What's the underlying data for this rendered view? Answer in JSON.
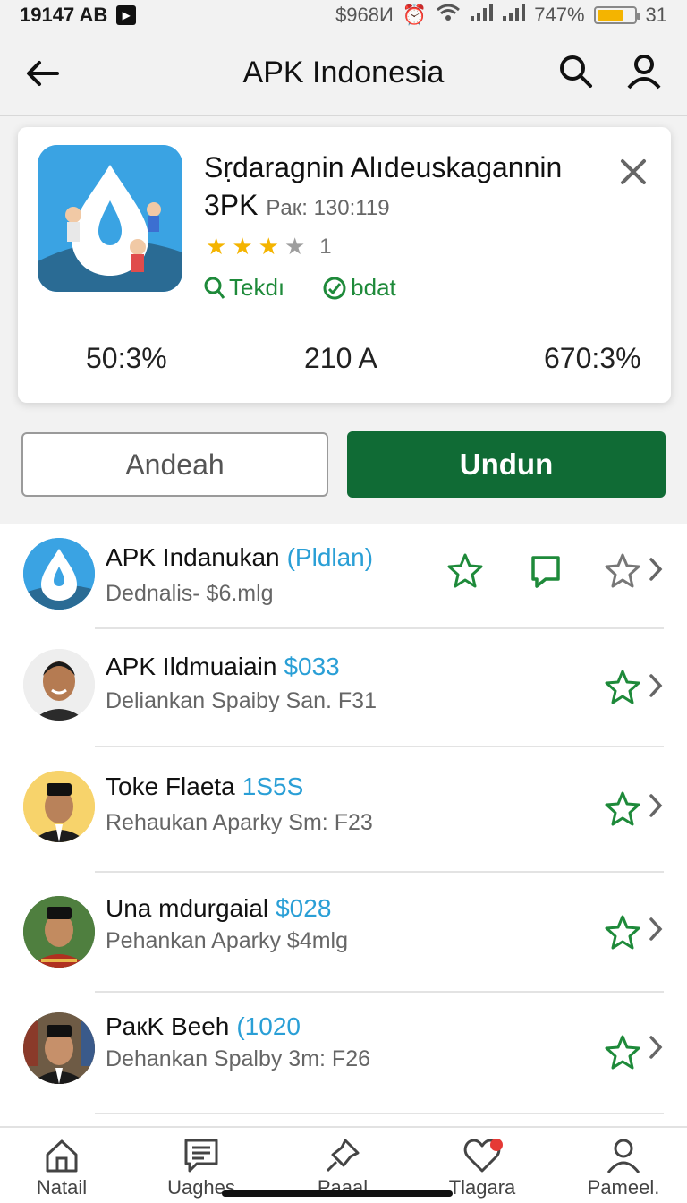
{
  "status_bar": {
    "time": "19147 AB",
    "carrier_text": "$968И",
    "battery_percent": "747%",
    "battery_extra": "31",
    "battery_level": 0.74
  },
  "header": {
    "title": "APK Indonesia",
    "icons": [
      "back-arrow-icon",
      "search-icon",
      "profile-icon"
    ]
  },
  "app_card": {
    "title_line1": "Sṛdaragnin Alıdeuskagannin",
    "title_line2_main": "3PK",
    "title_line2_small": "Paк: 130:119",
    "rating_stars": 3,
    "rating_max": 4,
    "rating_count": "1",
    "tag_one": "Tekdı",
    "tag_two": "bdat",
    "stats": [
      "50:3%",
      "210 A",
      "670:3%"
    ]
  },
  "buttons": {
    "secondary": "Andeah",
    "primary": "Undun"
  },
  "list": [
    {
      "name": "APK Indanukan",
      "price": "(Pldlan)",
      "sub": "Dednalis- $6.mlg"
    },
    {
      "name": "APK Ildmuaiain",
      "price": "$033",
      "sub": "Deliankan Spaiby San. F31"
    },
    {
      "name": "Toke Flaeta",
      "price": "1S5S",
      "sub": "Rehaukan Aparky  Sm: F23"
    },
    {
      "name": "Una mdurgaial",
      "price": "$028",
      "sub": "Pehankan Aparky  $4mlg"
    },
    {
      "name": "PaкK Beeh",
      "price": "(1020",
      "sub": "Dehankan Spalby  3m: F26"
    }
  ],
  "bottom_nav": [
    {
      "label": "Natail",
      "icon": "home-icon"
    },
    {
      "label": "Uaghes",
      "icon": "document-icon"
    },
    {
      "label": "Paaal",
      "icon": "pin-icon"
    },
    {
      "label": "Tlagara",
      "icon": "heart-icon"
    },
    {
      "label": "Pameel.",
      "icon": "person-icon"
    }
  ],
  "colors": {
    "primary_green": "#106b35",
    "accent_green": "#1e8a3a",
    "price_blue": "#2a9fd6",
    "star_gold": "#f4b400"
  }
}
